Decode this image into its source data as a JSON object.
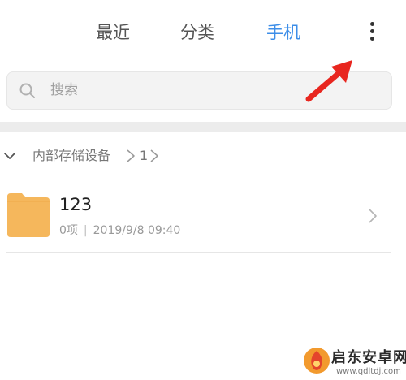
{
  "tabs": {
    "recent": "最近",
    "category": "分类",
    "phone": "手机",
    "active_color": "#3d8ee8"
  },
  "toolbar": {
    "more_icon": "more-vertical-icon"
  },
  "search": {
    "placeholder": "搜索",
    "icon": "search-icon"
  },
  "breadcrumb": {
    "root": "内部存储设备",
    "child": "1"
  },
  "files": [
    {
      "name": "123",
      "count": "0项",
      "date": "2019/9/8 09:40",
      "icon": "folder-icon",
      "icon_color": "#f5b75c"
    }
  ],
  "annotation": {
    "arrow_color": "#e8261f"
  },
  "watermark": {
    "title": "启东安卓网",
    "url": "www.qdltdj.com"
  }
}
